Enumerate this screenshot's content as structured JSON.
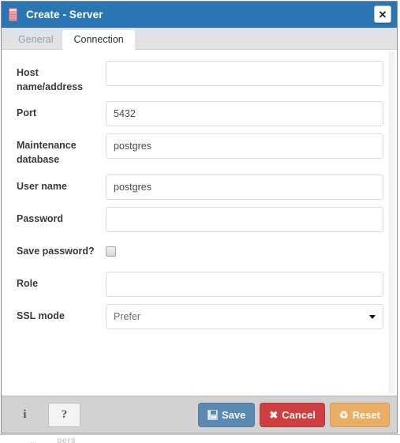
{
  "window": {
    "title": "Create - Server",
    "icon": "server-icon",
    "close_label": "✕"
  },
  "tabs": [
    {
      "label": "General",
      "active": false
    },
    {
      "label": "Connection",
      "active": true
    }
  ],
  "form": {
    "fields": [
      {
        "label": "Host name/address",
        "value": "",
        "placeholder": "",
        "type": "text"
      },
      {
        "label": "Port",
        "value": "5432",
        "placeholder": "",
        "type": "text"
      },
      {
        "label": "Maintenance database",
        "value": "postgres",
        "placeholder": "",
        "type": "text"
      },
      {
        "label": "User name",
        "value": "postgres",
        "placeholder": "",
        "type": "text"
      },
      {
        "label": "Password",
        "value": "",
        "placeholder": "",
        "type": "password"
      },
      {
        "label": "Save password?",
        "value": "",
        "checked": false,
        "type": "checkbox"
      },
      {
        "label": "Role",
        "value": "",
        "placeholder": "",
        "type": "text"
      },
      {
        "label": "SSL mode",
        "value": "Prefer",
        "type": "select"
      }
    ]
  },
  "footer": {
    "info_label": "i",
    "help_label": "?",
    "save_label": "Save",
    "cancel_label": "Cancel",
    "reset_label": "Reset",
    "cancel_glyph": "✖",
    "reset_glyph": "♻"
  },
  "colors": {
    "titlebar": "#2a76b5",
    "save": "#4a7fae",
    "cancel": "#cf2b2b",
    "reset": "#eeaa55",
    "footer": "#d2d2d2",
    "tab_inactive_text": "#8ba3bd"
  },
  "background": {
    "ghost_text": "pers",
    "ghost_text2": "..."
  }
}
